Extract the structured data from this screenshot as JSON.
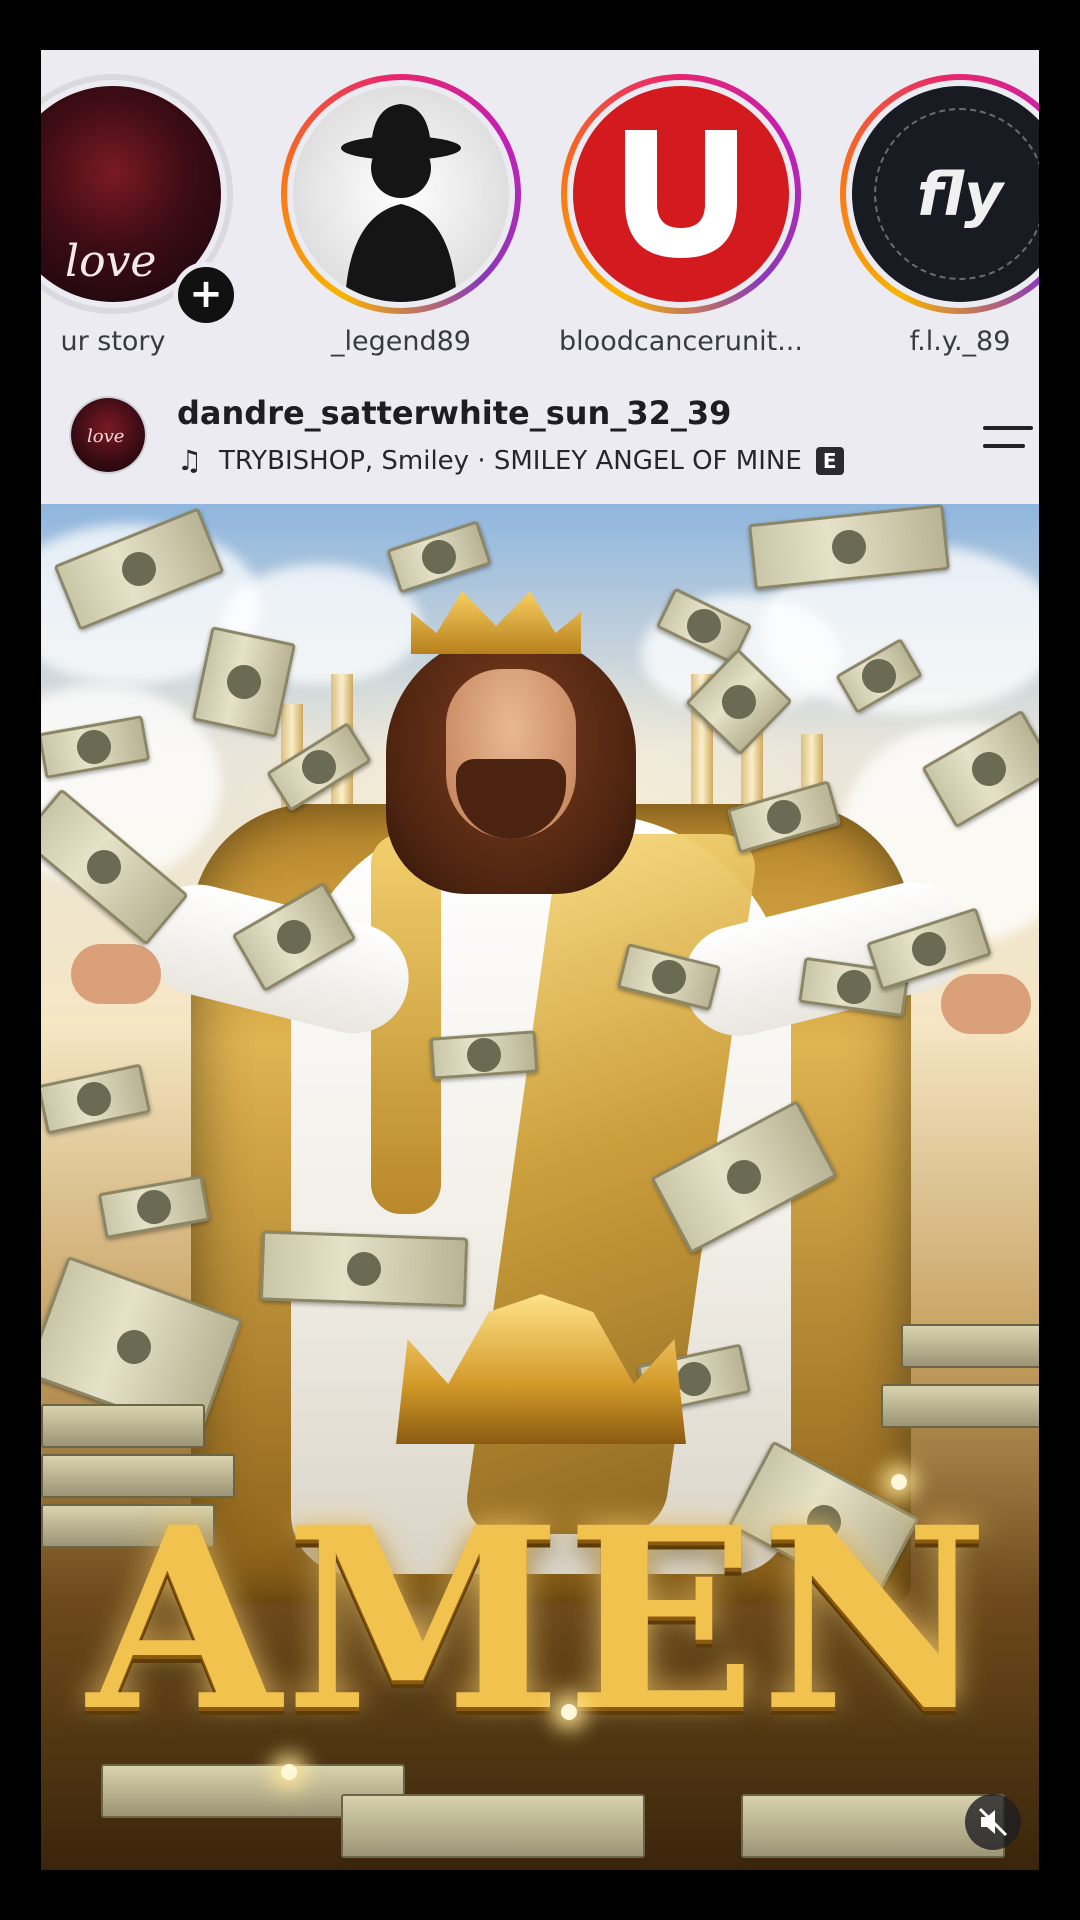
{
  "stories": [
    {
      "label": "ur story",
      "avatar_text": "love",
      "add_icon": "+"
    },
    {
      "label": "_legend89"
    },
    {
      "label": "bloodcancerunit..."
    },
    {
      "label": "f.l.y._89",
      "avatar_text": "fly"
    }
  ],
  "post": {
    "username": "dandre_satterwhite_sun_32_39",
    "audio": "TRYBISHOP, Smiley · SMILEY ANGEL OF MINE",
    "explicit_badge": "E",
    "avatar_text": "love",
    "image_text": "AMEN"
  },
  "icons": {
    "music": "music-note-icon",
    "menu": "menu-icon",
    "mute": "speaker-muted-icon",
    "add": "plus-icon"
  },
  "colors": {
    "screen_bg": "#ebebf1",
    "story_ring": "#e8276a",
    "blood_logo": "#d31a1f"
  }
}
